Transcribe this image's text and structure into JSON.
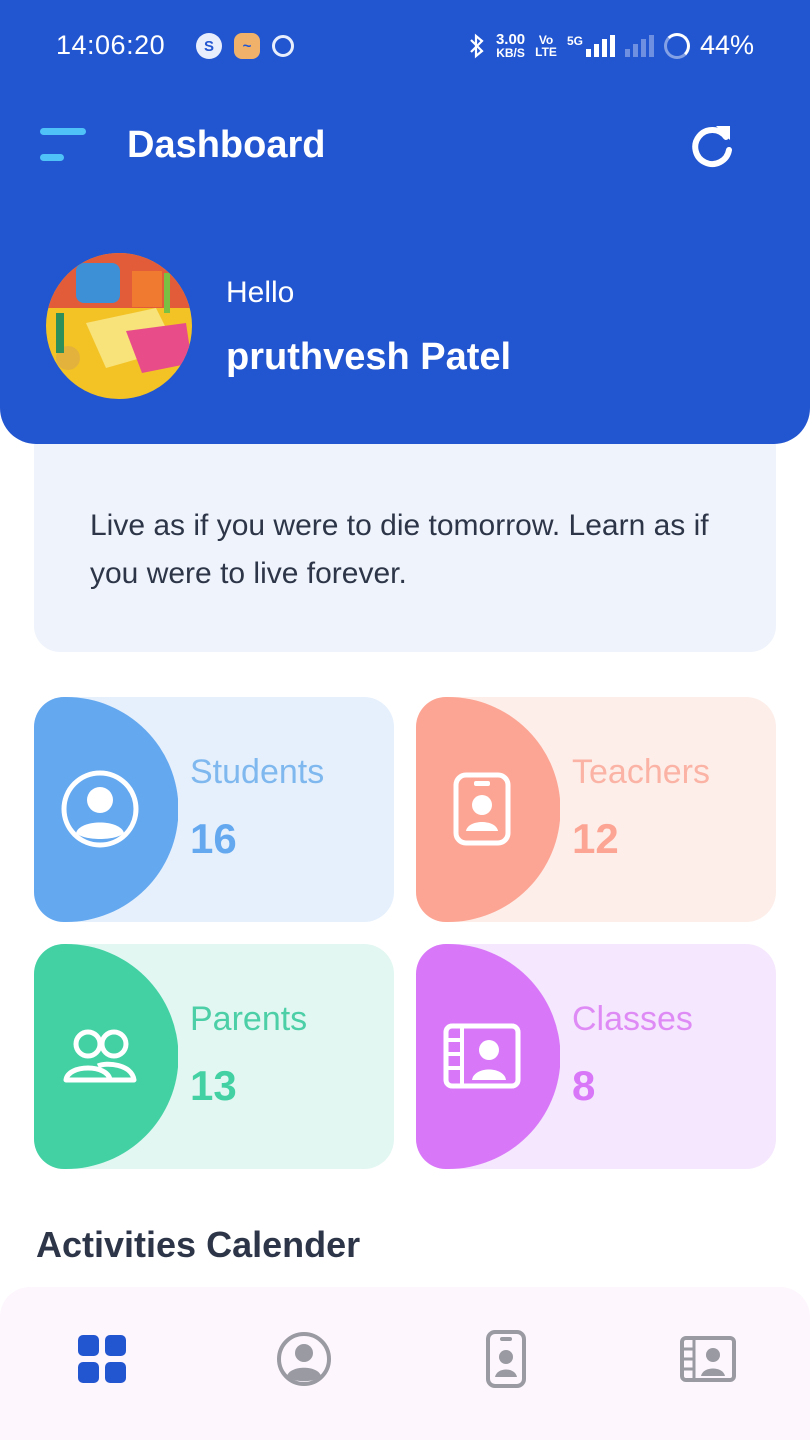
{
  "status_bar": {
    "time": "14:06:20",
    "speed_value": "3.00",
    "speed_unit": "KB/S",
    "volte_top": "Vo",
    "volte_bottom": "LTE",
    "network": "5G",
    "battery": "44%"
  },
  "header": {
    "title": "Dashboard",
    "greeting": "Hello",
    "user_name": "pruthvesh Patel"
  },
  "quote": {
    "text": "Live as if you were to die tomorrow. Learn as if you were to live forever."
  },
  "stats": {
    "students": {
      "label": "Students",
      "value": "16",
      "color": "#64a8f0",
      "text_color": "#7fb8ee",
      "bg": "#e5f0fc"
    },
    "teachers": {
      "label": "Teachers",
      "value": "12",
      "color": "#fda594",
      "text_color": "#fbb3a5",
      "bg": "#fdeee9"
    },
    "parents": {
      "label": "Parents",
      "value": "13",
      "color": "#43d1a4",
      "text_color": "#4ccfa6",
      "bg": "#e2f7f1"
    },
    "classes": {
      "label": "Classes",
      "value": "8",
      "color": "#d878f8",
      "text_color": "#df8bf6",
      "bg": "#f5e7fd"
    }
  },
  "section": {
    "activities_title": "Activities Calender"
  },
  "bottom_nav": {
    "items": [
      "dashboard-icon",
      "students-icon",
      "teachers-icon",
      "classes-icon"
    ],
    "active": "dashboard-icon",
    "active_color": "#2255d0",
    "inactive_color": "#9a9aa2"
  },
  "colors": {
    "primary": "#2255d0",
    "menu_accent": "#4fc3f7"
  }
}
